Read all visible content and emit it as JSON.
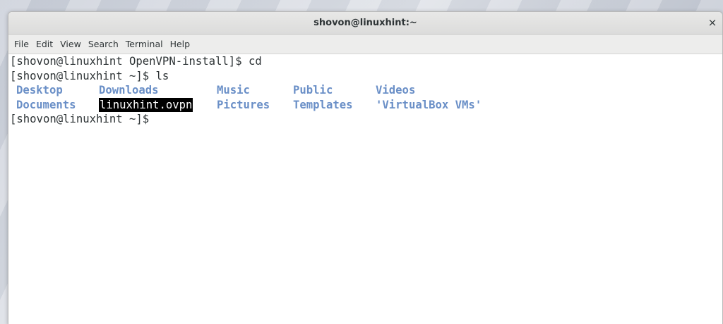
{
  "window": {
    "title": "shovon@linuxhint:~",
    "close_symbol": "×"
  },
  "menu": [
    "File",
    "Edit",
    "View",
    "Search",
    "Terminal",
    "Help"
  ],
  "terminal": {
    "lines": [
      "[shovon@linuxhint OpenVPN-install]$ cd",
      "[shovon@linuxhint ~]$ ls"
    ],
    "ls_output": [
      [
        "Desktop",
        "Downloads",
        "Music",
        "Public",
        "Videos"
      ],
      [
        "Documents",
        "linuxhint.ovpn",
        "Pictures",
        "Templates",
        "'VirtualBox VMs'"
      ]
    ],
    "prompt": "[shovon@linuxhint ~]$"
  },
  "colors": {
    "directory": "#6a8fc7",
    "highlight_bg": "#000000",
    "highlight_fg": "#ffffff"
  }
}
